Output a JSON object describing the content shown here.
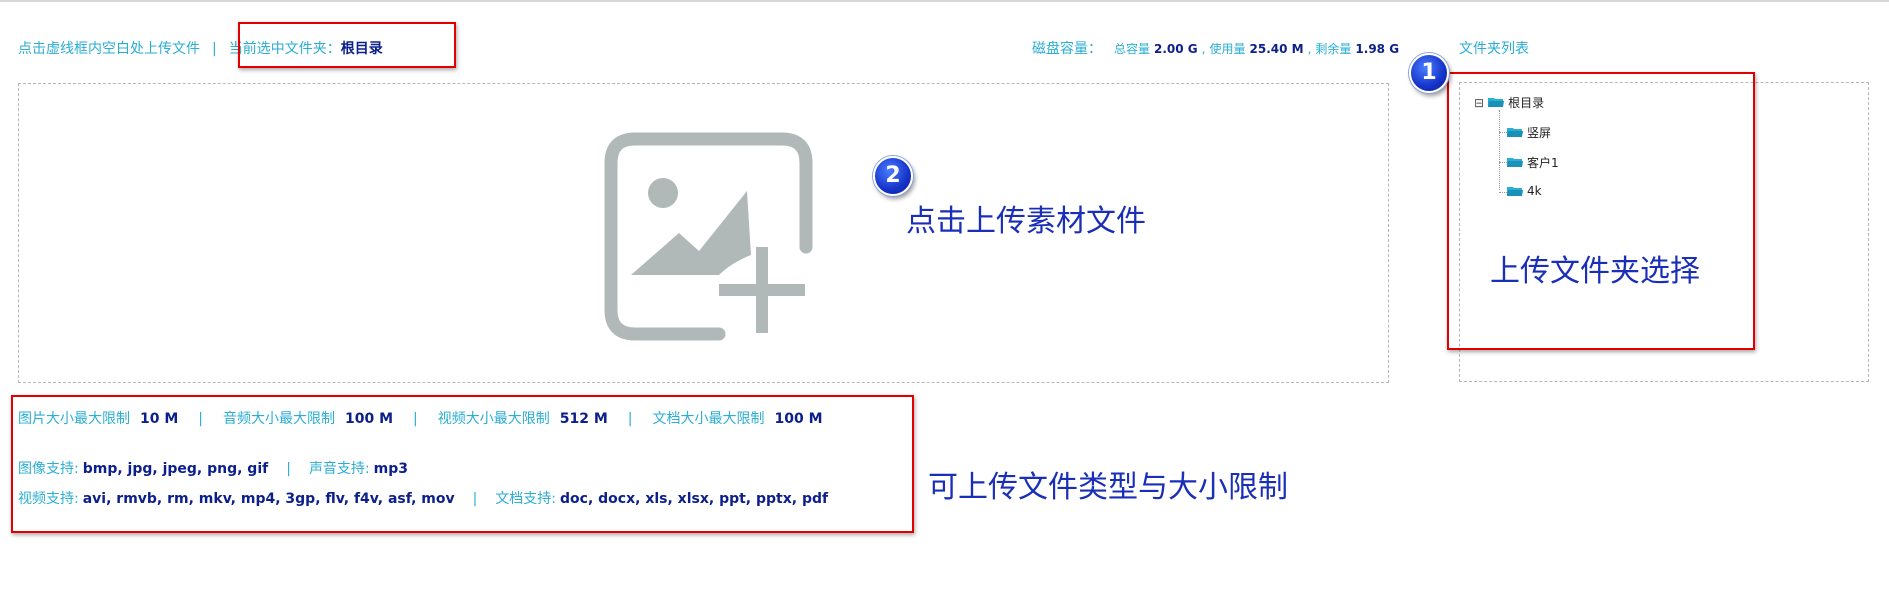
{
  "header": {
    "upload_hint": "点击虚线框内空白处上传文件",
    "sep": "|",
    "current_folder_label": "当前选中文件夹：",
    "current_folder_value": "根目录",
    "disk_label": "磁盘容量：",
    "total_label": "总容量",
    "total_value": "2.00 G",
    "used_label": "使用量",
    "used_value": "25.40 M",
    "remain_label": "剩余量",
    "remain_value": "1.98 G",
    "comma": ",",
    "folder_list_title": "文件夹列表"
  },
  "tree": {
    "toggle": "⊟",
    "root": "根目录",
    "children": [
      "竖屏",
      "客户1",
      "4k"
    ]
  },
  "annotations": {
    "badge1": "1",
    "badge2": "2",
    "upload_material": "点击上传素材文件",
    "folder_select": "上传文件夹选择",
    "type_limits": "可上传文件类型与大小限制"
  },
  "limits": {
    "image_label": "图片大小最大限制",
    "image_value": "10 M",
    "audio_label": "音频大小最大限制",
    "audio_value": "100 M",
    "video_label": "视频大小最大限制",
    "video_value": "512 M",
    "doc_label": "文档大小最大限制",
    "doc_value": "100 M",
    "sep": "|"
  },
  "support": {
    "image_label": "图像支持:",
    "image_value": "bmp, jpg, jpeg, png, gif",
    "audio_label": "声音支持:",
    "audio_value": "mp3",
    "video_label": "视频支持:",
    "video_value": "avi, rmvb, rm, mkv, mp4, 3gp, flv, f4v, asf, mov",
    "doc_label": "文档支持:",
    "doc_value": "doc, docx, xls, xlsx, ppt, pptx, pdf",
    "sep": "|"
  },
  "colors": {
    "accent": "#2aaed3",
    "value": "#0c1f8a",
    "annotation": "#1a2fb8",
    "highlight": "#e00000",
    "icon": "#b0b8b8",
    "folder": "#2aaed3"
  }
}
